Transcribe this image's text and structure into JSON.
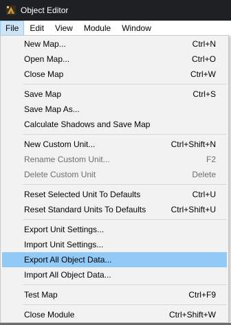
{
  "window": {
    "title": "Object Editor",
    "icon": "object-editor-app-icon"
  },
  "menubar": {
    "items": [
      {
        "label": "File"
      },
      {
        "label": "Edit"
      },
      {
        "label": "View"
      },
      {
        "label": "Module"
      },
      {
        "label": "Window"
      }
    ]
  },
  "file_menu": {
    "items": [
      {
        "label": "New Map...",
        "shortcut": "Ctrl+N"
      },
      {
        "label": "Open Map...",
        "shortcut": "Ctrl+O"
      },
      {
        "label": "Close Map",
        "shortcut": "Ctrl+W"
      },
      {
        "label": "Save Map",
        "shortcut": "Ctrl+S"
      },
      {
        "label": "Save Map As...",
        "shortcut": ""
      },
      {
        "label": "Calculate Shadows and Save Map",
        "shortcut": ""
      },
      {
        "label": "New Custom Unit...",
        "shortcut": "Ctrl+Shift+N"
      },
      {
        "label": "Rename Custom Unit...",
        "shortcut": "F2"
      },
      {
        "label": "Delete Custom Unit",
        "shortcut": "Delete"
      },
      {
        "label": "Reset Selected Unit To Defaults",
        "shortcut": "Ctrl+U"
      },
      {
        "label": "Reset Standard Units To Defaults",
        "shortcut": "Ctrl+Shift+U"
      },
      {
        "label": "Export Unit Settings...",
        "shortcut": ""
      },
      {
        "label": "Import Unit Settings...",
        "shortcut": ""
      },
      {
        "label": "Export All Object Data...",
        "shortcut": ""
      },
      {
        "label": "Import All Object Data...",
        "shortcut": ""
      },
      {
        "label": "Test Map",
        "shortcut": "Ctrl+F9"
      },
      {
        "label": "Close Module",
        "shortcut": "Ctrl+Shift+W"
      }
    ]
  },
  "colors": {
    "titlebar_bg": "#1f2024",
    "menu_open_bg": "#cce4f7",
    "highlight_bg": "#91c9f7",
    "disabled_text": "#6d6d6d"
  }
}
